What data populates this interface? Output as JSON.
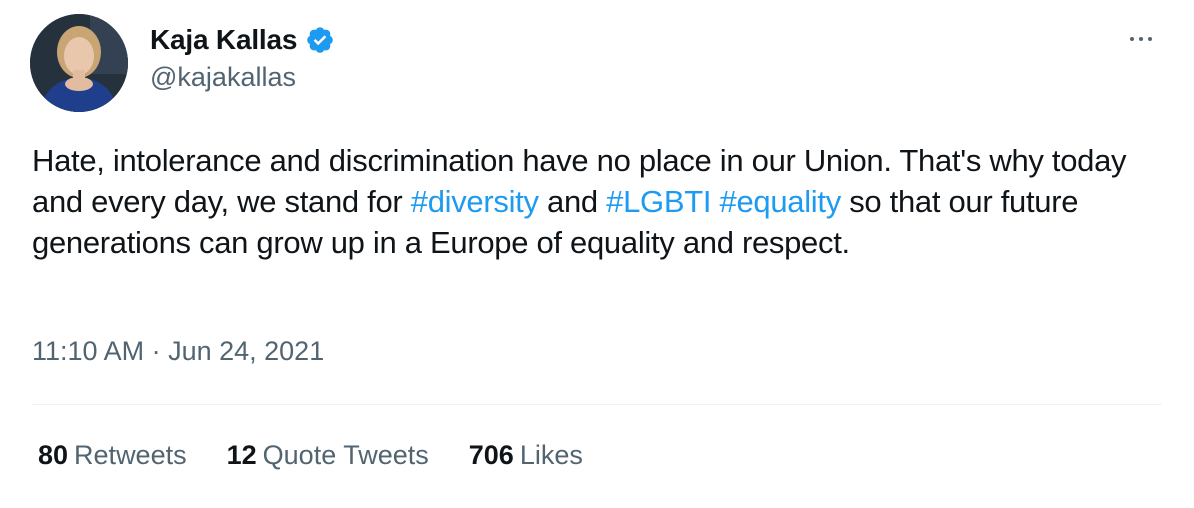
{
  "author": {
    "display_name": "Kaja Kallas",
    "handle": "@kajakallas",
    "verified": true,
    "avatar_icon": "profile-photo"
  },
  "more_icon": "more-horizontal-icon",
  "text": {
    "part1": "Hate, intolerance and discrimination have no place in our Union. That's why today and every day, we stand for ",
    "hashtag1": "#diversity",
    "part2": " and ",
    "hashtag2": "#LGBTI",
    "part3": " ",
    "hashtag3": "#equality",
    "part4": " so that our future generations can grow up in a Europe of equality and respect."
  },
  "timestamp": {
    "time": "11:10 AM",
    "separator": " · ",
    "date": "Jun 24, 2021"
  },
  "stats": {
    "retweets_count": "80",
    "retweets_label": "Retweets",
    "quotes_count": "12",
    "quotes_label": "Quote Tweets",
    "likes_count": "706",
    "likes_label": "Likes"
  },
  "colors": {
    "link": "#1d9bf0",
    "secondary_text": "#536471",
    "primary_text": "#0f1419",
    "divider": "#eff3f4"
  }
}
